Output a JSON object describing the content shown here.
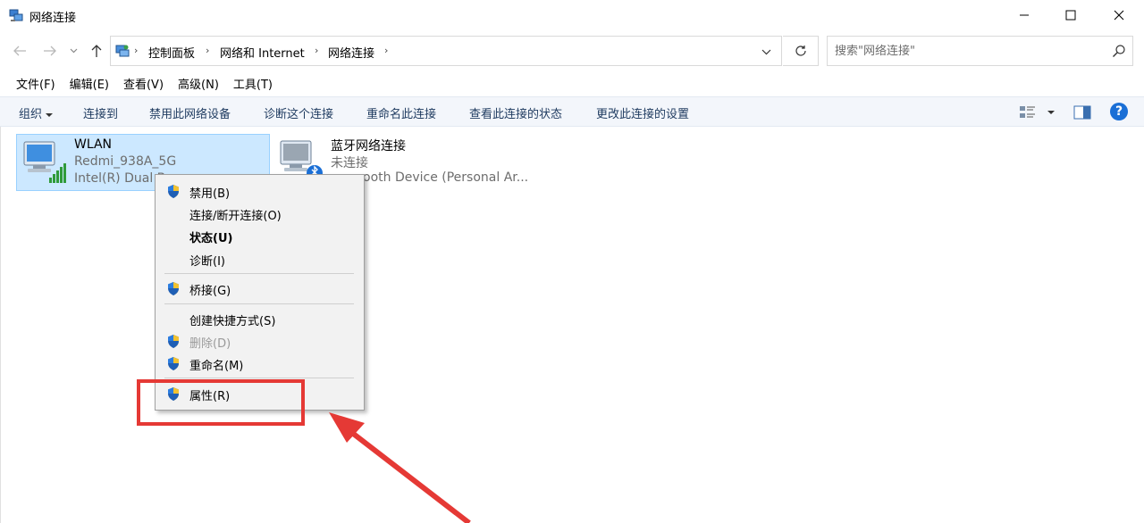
{
  "window": {
    "title": "网络连接",
    "accent": "#1a6fd6"
  },
  "address": {
    "breadcrumbs": [
      "控制面板",
      "网络和 Internet",
      "网络连接"
    ]
  },
  "search": {
    "placeholder": "搜索\"网络连接\""
  },
  "menubar": {
    "items": [
      "文件(F)",
      "编辑(E)",
      "查看(V)",
      "高级(N)",
      "工具(T)"
    ]
  },
  "cmdbar": {
    "organize": "组织",
    "connect": "连接到",
    "disable": "禁用此网络设备",
    "diagnose": "诊断这个连接",
    "rename": "重命名此连接",
    "status": "查看此连接的状态",
    "settings": "更改此连接的设置",
    "help": "?"
  },
  "connections": [
    {
      "name": "WLAN",
      "network": "Redmi_938A_5G",
      "device": "Intel(R) Dual B"
    },
    {
      "name": "蓝牙网络连接",
      "network": "未连接",
      "device": "ooth Device (Personal Ar..."
    }
  ],
  "context_menu": {
    "items": [
      {
        "label": "禁用(B)",
        "shield": true
      },
      {
        "label": "连接/断开连接(O)",
        "shield": false
      },
      {
        "label": "状态(U)",
        "shield": false,
        "bold": true
      },
      {
        "label": "诊断(I)",
        "shield": false
      },
      {
        "label": "桥接(G)",
        "shield": true
      },
      {
        "label": "创建快捷方式(S)",
        "shield": false
      },
      {
        "label": "删除(D)",
        "shield": true,
        "disabled": true
      },
      {
        "label": "重命名(M)",
        "shield": true
      },
      {
        "label": "属性(R)",
        "shield": true
      }
    ]
  },
  "annotation": {
    "color": "#e53935"
  }
}
